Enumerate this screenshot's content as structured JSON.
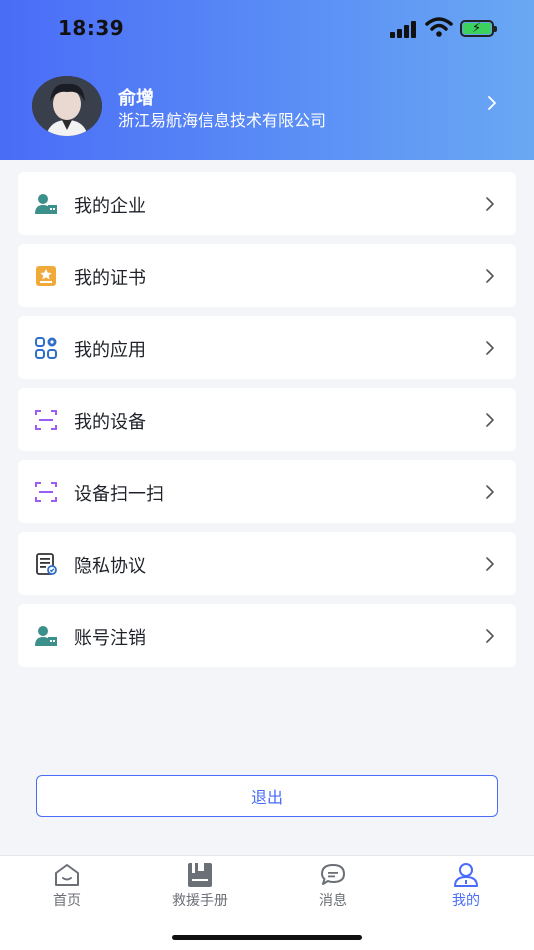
{
  "status_bar": {
    "time": "18:39"
  },
  "profile": {
    "name": "俞增",
    "company": "浙江易航海信息技术有限公司"
  },
  "menu": [
    {
      "label": "我的企业",
      "icon": "user-building-icon"
    },
    {
      "label": "我的证书",
      "icon": "certificate-icon"
    },
    {
      "label": "我的应用",
      "icon": "apps-icon"
    },
    {
      "label": "我的设备",
      "icon": "scan-frame-icon"
    },
    {
      "label": "设备扫一扫",
      "icon": "scan-frame-icon"
    },
    {
      "label": "隐私协议",
      "icon": "document-icon"
    },
    {
      "label": "账号注销",
      "icon": "user-building-icon"
    }
  ],
  "logout_label": "退出",
  "tabbar": {
    "items": [
      {
        "label": "首页",
        "icon": "home-icon"
      },
      {
        "label": "救援手册",
        "icon": "manual-icon"
      },
      {
        "label": "消息",
        "icon": "message-icon"
      },
      {
        "label": "我的",
        "icon": "user-icon"
      }
    ],
    "active_index": 3
  },
  "colors": {
    "accent": "#4a6cf7",
    "header_start": "#4a6cf7",
    "header_end": "#6aa8f3"
  }
}
